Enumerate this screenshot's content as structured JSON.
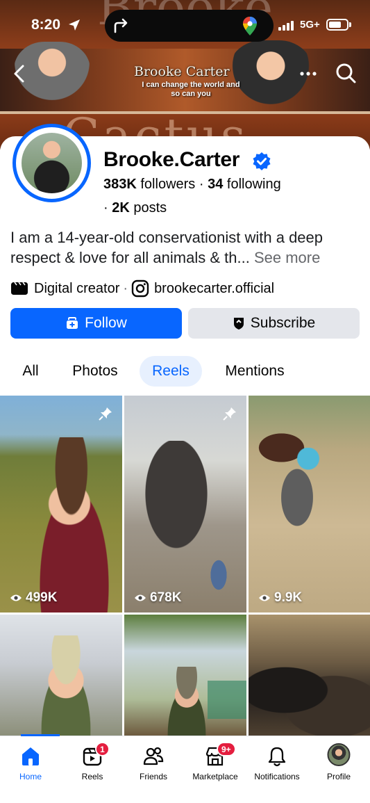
{
  "status_bar": {
    "time": "8:20",
    "network": "5G+"
  },
  "cover": {
    "title": "Brooke Carter",
    "subtitle": "I can change the world and so can you"
  },
  "profile": {
    "name": "Brooke.Carter",
    "followers_count": "383K",
    "followers_label": "followers",
    "following_count": "34",
    "following_label": "following",
    "posts_count": "2K",
    "posts_label": "posts",
    "bio": "I am a 14-year-old conservationist with a deep respect & love for all animals & th...",
    "see_more": "See more",
    "category": "Digital creator",
    "instagram": "brookecarter.official"
  },
  "actions": {
    "follow": "Follow",
    "subscribe": "Subscribe"
  },
  "tabs": [
    {
      "label": "All"
    },
    {
      "label": "Photos"
    },
    {
      "label": "Reels",
      "active": true
    },
    {
      "label": "Mentions"
    }
  ],
  "reels": [
    {
      "views": "499K",
      "pinned": true
    },
    {
      "views": "678K",
      "pinned": true
    },
    {
      "views": "9.9K",
      "pinned": false
    },
    {
      "views": "",
      "pinned": false
    },
    {
      "views": "",
      "pinned": false
    },
    {
      "views": "",
      "pinned": false
    }
  ],
  "bottom_nav": [
    {
      "label": "Home",
      "icon": "home-icon",
      "active": true
    },
    {
      "label": "Reels",
      "icon": "reels-icon",
      "badge": "1"
    },
    {
      "label": "Friends",
      "icon": "friends-icon"
    },
    {
      "label": "Marketplace",
      "icon": "marketplace-icon",
      "badge": "9+"
    },
    {
      "label": "Notifications",
      "icon": "bell-icon"
    },
    {
      "label": "Profile",
      "icon": "profile-avatar"
    }
  ],
  "colors": {
    "accent": "#0866ff",
    "badge": "#e41e3f",
    "secondary_button": "#e4e6eb"
  }
}
